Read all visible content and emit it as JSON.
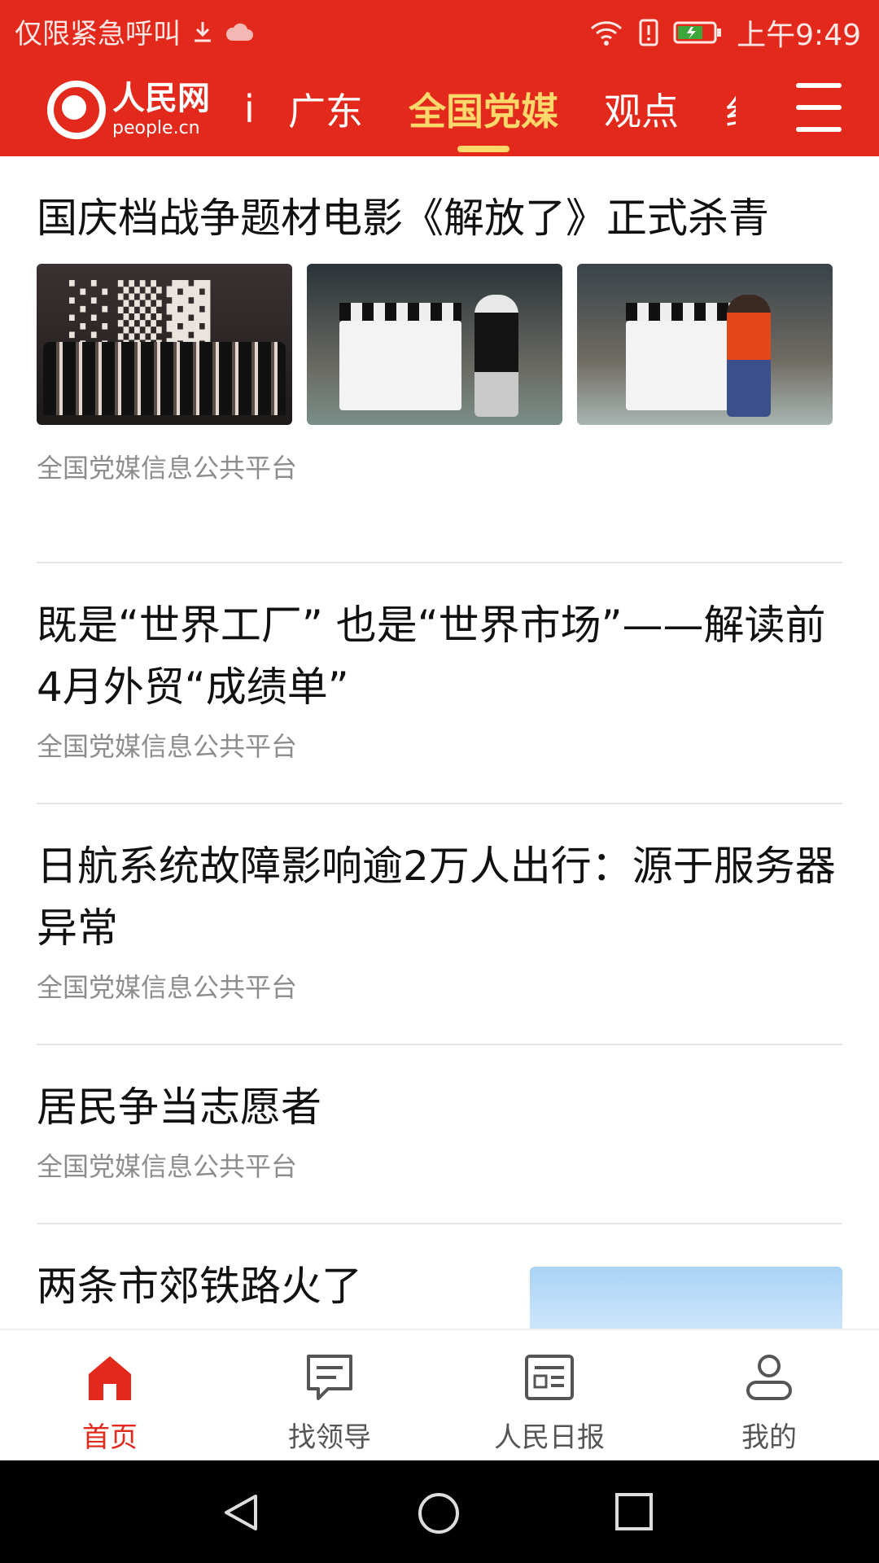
{
  "status_bar": {
    "left_text": "仅限紧急呼叫",
    "time": "上午9:49"
  },
  "app": {
    "logo_cn": "人民网",
    "logo_en": "people.cn"
  },
  "nav": {
    "tabs": [
      {
        "label": "i",
        "active": false
      },
      {
        "label": "广东",
        "active": false
      },
      {
        "label": "全国党媒",
        "active": true
      },
      {
        "label": "观点",
        "active": false
      },
      {
        "label": "纟",
        "active": false
      }
    ]
  },
  "feed": {
    "items": [
      {
        "title": "国庆档战争题材电影《解放了》正式杀青",
        "source": "全国党媒信息公共平台",
        "images": [
          "group-photo",
          "clapperboard-man",
          "clapperboard-woman"
        ]
      },
      {
        "title": "既是“世界工厂” 也是“世界市场”——解读前4月外贸“成绩单”",
        "source": "全国党媒信息公共平台"
      },
      {
        "title": "日航系统故障影响逾2万人出行：源于服务器异常",
        "source": "全国党媒信息公共平台"
      },
      {
        "title": "居民争当志愿者",
        "source": "全国党媒信息公共平台"
      },
      {
        "title": "两条市郊铁路火了",
        "source": ""
      }
    ]
  },
  "bottom_tabs": [
    {
      "label": "首页",
      "icon": "home-icon",
      "active": true
    },
    {
      "label": "找领导",
      "icon": "message-icon",
      "active": false
    },
    {
      "label": "人民日报",
      "icon": "newspaper-icon",
      "active": false
    },
    {
      "label": "我的",
      "icon": "user-icon",
      "active": false
    }
  ],
  "colors": {
    "brand_red": "#e2291c",
    "active_tab": "#ffd86b",
    "source_gray": "#8d8d8d"
  }
}
